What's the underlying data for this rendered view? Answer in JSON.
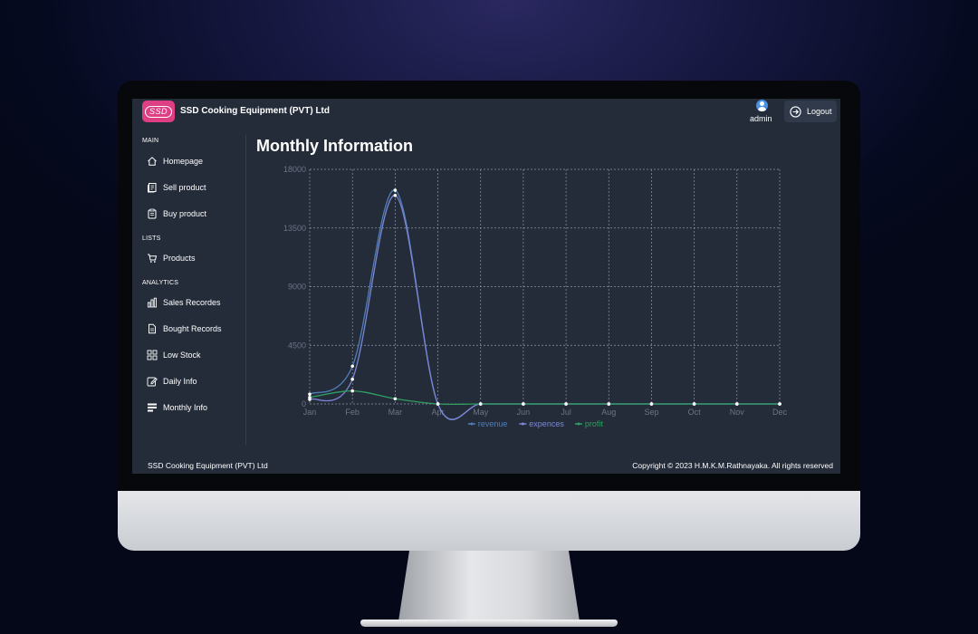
{
  "app": {
    "logo_text": "SSD",
    "company_name": "SSD Cooking Equipment (PVT) Ltd",
    "user": "admin",
    "logout_label": "Logout"
  },
  "sidebar": {
    "main_label": "MAIN",
    "lists_label": "LISTS",
    "analytics_label": "ANALYTICS",
    "items": [
      {
        "label": "Homepage",
        "icon": "home-icon"
      },
      {
        "label": "Sell product",
        "icon": "sell-icon"
      },
      {
        "label": "Buy product",
        "icon": "clipboard-icon"
      },
      {
        "label": "Products",
        "icon": "cart-icon"
      },
      {
        "label": "Sales Recordes",
        "icon": "bar-chart-icon"
      },
      {
        "label": "Bought Records",
        "icon": "document-icon"
      },
      {
        "label": "Low Stock",
        "icon": "grid-icon"
      },
      {
        "label": "Daily Info",
        "icon": "edit-icon"
      },
      {
        "label": "Monthly Info",
        "icon": "list-icon"
      }
    ]
  },
  "main": {
    "title": "Monthly Information"
  },
  "footer": {
    "left": "SSD Cooking Equipment (PVT) Ltd",
    "right": "Copyright © 2023 H.M.K.M.Rathnayaka. All rights reserved"
  },
  "chart_data": {
    "type": "line",
    "categories": [
      "Jan",
      "Feb",
      "Mar",
      "Apr",
      "May",
      "Jun",
      "Jul",
      "Aug",
      "Sep",
      "Oct",
      "Nov",
      "Dec"
    ],
    "y_ticks": [
      0,
      4500,
      9000,
      13500,
      18000
    ],
    "ylim": [
      0,
      18000
    ],
    "grid": true,
    "legend_position": "bottom",
    "series": [
      {
        "name": "revenue",
        "color": "#4f7fb8",
        "values": [
          750,
          2900,
          16400,
          0,
          0,
          0,
          0,
          0,
          0,
          0,
          0,
          0
        ]
      },
      {
        "name": "expences",
        "color": "#7c86d6",
        "values": [
          350,
          1900,
          16000,
          0,
          0,
          0,
          0,
          0,
          0,
          0,
          0,
          0
        ]
      },
      {
        "name": "profit",
        "color": "#2e9e62",
        "values": [
          500,
          1000,
          400,
          0,
          0,
          0,
          0,
          0,
          0,
          0,
          0,
          0
        ]
      }
    ]
  }
}
